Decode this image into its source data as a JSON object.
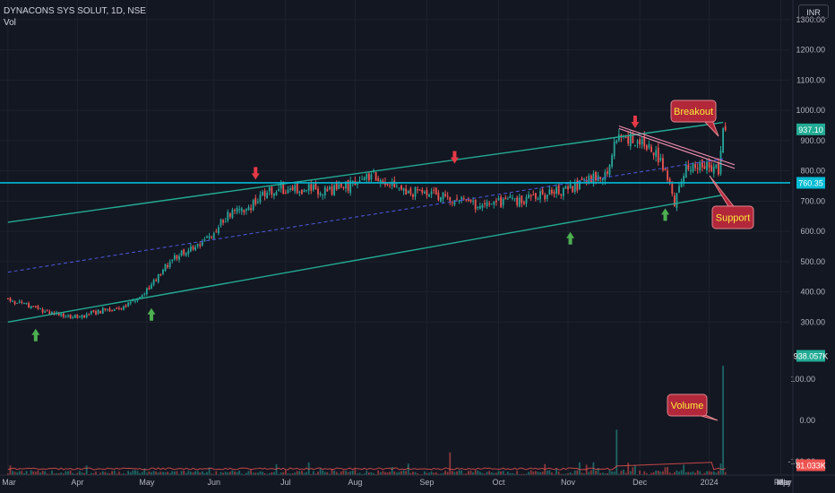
{
  "header": {
    "title": "DYNACONS SYS SOLUT, 1D, NSE",
    "indicator": "Vol"
  },
  "currency_button": "INR",
  "colors": {
    "background": "#131722",
    "grid": "#1e222d",
    "text": "#b2b5be",
    "up": "#26a69a",
    "down": "#ef5350",
    "channel": "#22ab94",
    "midline": "#4d59e0",
    "support": "#00bcd4",
    "wedge": "#f48fb1",
    "callout": "#b2283a",
    "callout_text": "#ffeb3b",
    "arrow_up": "#4caf50",
    "arrow_down": "#e53945"
  },
  "chart_data": {
    "type": "candlestick",
    "title": "DYNACONS SYS SOLUT, 1D, NSE",
    "x_ticks": [
      "Mar",
      "Apr",
      "May",
      "Jun",
      "Jul",
      "Aug",
      "Sep",
      "Oct",
      "Nov",
      "Dec",
      "2024",
      "Feb",
      "Mar",
      "Apr",
      "May"
    ],
    "price_ticks": [
      "1300.00",
      "1200.00",
      "1100.00",
      "1000.00",
      "900.00",
      "800.00",
      "700.00",
      "600.00",
      "500.00",
      "400.00",
      "300.00"
    ],
    "volume_ticks": [
      "100.00",
      "0.00",
      "-100.00"
    ],
    "price_labels": {
      "last_price": "937.10",
      "support_level": "760.35"
    },
    "volume_labels": {
      "last_volume": "938.057K",
      "volume_ma": "81.033K"
    },
    "price_anchors": [
      [
        0,
        375
      ],
      [
        10,
        352
      ],
      [
        20,
        328
      ],
      [
        30,
        316
      ],
      [
        40,
        338
      ],
      [
        50,
        352
      ],
      [
        58,
        382
      ],
      [
        65,
        458
      ],
      [
        72,
        512
      ],
      [
        78,
        538
      ],
      [
        82,
        560
      ],
      [
        90,
        605
      ],
      [
        95,
        655
      ],
      [
        104,
        676
      ],
      [
        110,
        718
      ],
      [
        116,
        745
      ],
      [
        122,
        732
      ],
      [
        130,
        742
      ],
      [
        140,
        738
      ],
      [
        149,
        752
      ],
      [
        158,
        788
      ],
      [
        165,
        748
      ],
      [
        175,
        730
      ],
      [
        190,
        712
      ],
      [
        197,
        700
      ],
      [
        205,
        680
      ],
      [
        215,
        698
      ],
      [
        228,
        712
      ],
      [
        242,
        738
      ],
      [
        252,
        772
      ],
      [
        259,
        800
      ],
      [
        264,
        925
      ],
      [
        268,
        912
      ],
      [
        275,
        880
      ],
      [
        280,
        862
      ],
      [
        285,
        772
      ],
      [
        288,
        700
      ],
      [
        293,
        808
      ],
      [
        298,
        812
      ],
      [
        303,
        818
      ],
      [
        307,
        798
      ],
      [
        309,
        935
      ]
    ],
    "annotations": [
      "Breakout",
      "Support",
      "Volume"
    ],
    "channel": {
      "upper": [
        [
          0,
          630
        ],
        [
          309,
          960
        ]
      ],
      "lower": [
        [
          0,
          300
        ],
        [
          309,
          720
        ]
      ],
      "mid": [
        [
          0,
          465
        ],
        [
          309,
          840
        ]
      ]
    },
    "support_line": 760.35,
    "arrows_down": [
      [
        107,
        765
      ],
      [
        193,
        818
      ],
      [
        271,
        935
      ]
    ],
    "arrows_up": [
      [
        12,
        284
      ],
      [
        62,
        352
      ],
      [
        243,
        604
      ],
      [
        284,
        682
      ]
    ]
  }
}
